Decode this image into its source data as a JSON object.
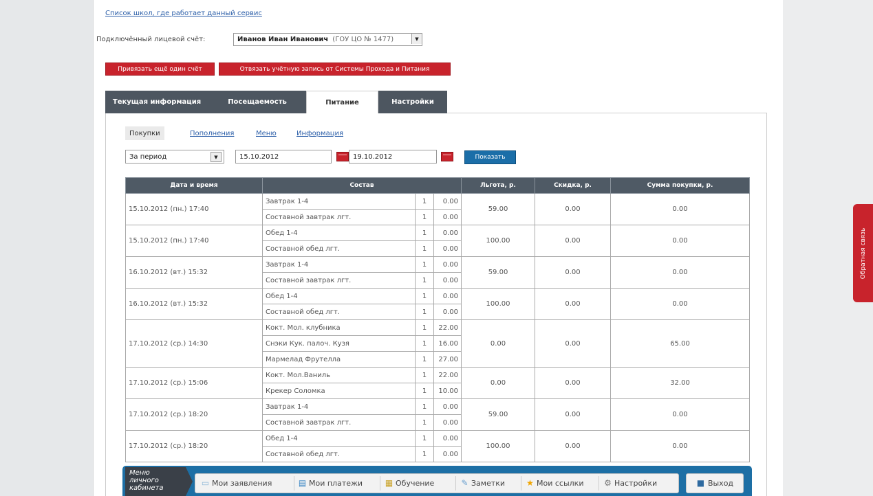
{
  "schools_link": "Список школ, где работает данный сервис",
  "account": {
    "label": "Подключённый лицевой счёт:",
    "name": "Иванов Иван Иванович",
    "school": "(ГОУ ЦО № 1477)"
  },
  "actions": {
    "bind_account": "Привязать ещё один счёт",
    "unbind_account": "Отвязать учётную запись от Системы Прохода и Питания"
  },
  "tabs": [
    "Текущая информация",
    "Посещаемость",
    "Питание",
    "Настройки"
  ],
  "subnav": [
    "Покупки",
    "Пополнения",
    "Меню",
    "Информация"
  ],
  "filter": {
    "period": "За период",
    "date_from": "15.10.2012",
    "date_to": "19.10.2012",
    "show": "Показать"
  },
  "table": {
    "headers": [
      "Дата и время",
      "Состав",
      "Льгота, р.",
      "Скидка, р.",
      "Сумма покупки, р."
    ],
    "purchases": [
      {
        "datetime": "15.10.2012 (пн.) 17:40",
        "items": [
          {
            "name": "Завтрак 1-4",
            "qty": "1",
            "price": "0.00"
          },
          {
            "name": "Составной завтрак лгт.",
            "qty": "1",
            "price": "0.00"
          }
        ],
        "benefit": "59.00",
        "discount": "0.00",
        "sum": "0.00"
      },
      {
        "datetime": "15.10.2012 (пн.) 17:40",
        "items": [
          {
            "name": "Обед 1-4",
            "qty": "1",
            "price": "0.00"
          },
          {
            "name": "Составной обед лгт.",
            "qty": "1",
            "price": "0.00"
          }
        ],
        "benefit": "100.00",
        "discount": "0.00",
        "sum": "0.00"
      },
      {
        "datetime": "16.10.2012 (вт.) 15:32",
        "items": [
          {
            "name": "Завтрак 1-4",
            "qty": "1",
            "price": "0.00"
          },
          {
            "name": "Составной завтрак лгт.",
            "qty": "1",
            "price": "0.00"
          }
        ],
        "benefit": "59.00",
        "discount": "0.00",
        "sum": "0.00"
      },
      {
        "datetime": "16.10.2012 (вт.) 15:32",
        "items": [
          {
            "name": "Обед 1-4",
            "qty": "1",
            "price": "0.00"
          },
          {
            "name": "Составной обед лгт.",
            "qty": "1",
            "price": "0.00"
          }
        ],
        "benefit": "100.00",
        "discount": "0.00",
        "sum": "0.00"
      },
      {
        "datetime": "17.10.2012 (ср.) 14:30",
        "items": [
          {
            "name": "Кокт. Мол. клубника",
            "qty": "1",
            "price": "22.00"
          },
          {
            "name": "Снэки Кук. палоч. Кузя",
            "qty": "1",
            "price": "16.00"
          },
          {
            "name": "Мармелад Фрутелла",
            "qty": "1",
            "price": "27.00"
          }
        ],
        "benefit": "0.00",
        "discount": "0.00",
        "sum": "65.00"
      },
      {
        "datetime": "17.10.2012 (ср.) 15:06",
        "items": [
          {
            "name": "Кокт. Мол.Ваниль",
            "qty": "1",
            "price": "22.00"
          },
          {
            "name": "Крекер Соломка",
            "qty": "1",
            "price": "10.00"
          }
        ],
        "benefit": "0.00",
        "discount": "0.00",
        "sum": "32.00"
      },
      {
        "datetime": "17.10.2012 (ср.) 18:20",
        "items": [
          {
            "name": "Завтрак 1-4",
            "qty": "1",
            "price": "0.00"
          },
          {
            "name": "Составной завтрак лгт.",
            "qty": "1",
            "price": "0.00"
          }
        ],
        "benefit": "59.00",
        "discount": "0.00",
        "sum": "0.00"
      },
      {
        "datetime": "17.10.2012 (ср.) 18:20",
        "items": [
          {
            "name": "Обед 1-4",
            "qty": "1",
            "price": "0.00"
          },
          {
            "name": "Составной обед лгт.",
            "qty": "1",
            "price": "0.00"
          }
        ],
        "benefit": "100.00",
        "discount": "0.00",
        "sum": "0.00"
      }
    ]
  },
  "bottom_menu": {
    "label_line1": "Меню",
    "label_line2": "личного",
    "label_line3": "кабинета",
    "items": [
      {
        "label": "Мои заявления",
        "icon": "document-icon"
      },
      {
        "label": "Мои платежи",
        "icon": "payments-icon"
      },
      {
        "label": "Обучение",
        "icon": "book-icon"
      },
      {
        "label": "Заметки",
        "icon": "notes-icon"
      },
      {
        "label": "Мои ссылки",
        "icon": "star-icon"
      },
      {
        "label": "Настройки",
        "icon": "settings-icon"
      }
    ],
    "exit": "Выход"
  },
  "feedback": "Обратная связь",
  "colors": {
    "accent_red": "#c8232c",
    "accent_blue": "#1d6fa5",
    "tab_dark": "#4d5660"
  }
}
